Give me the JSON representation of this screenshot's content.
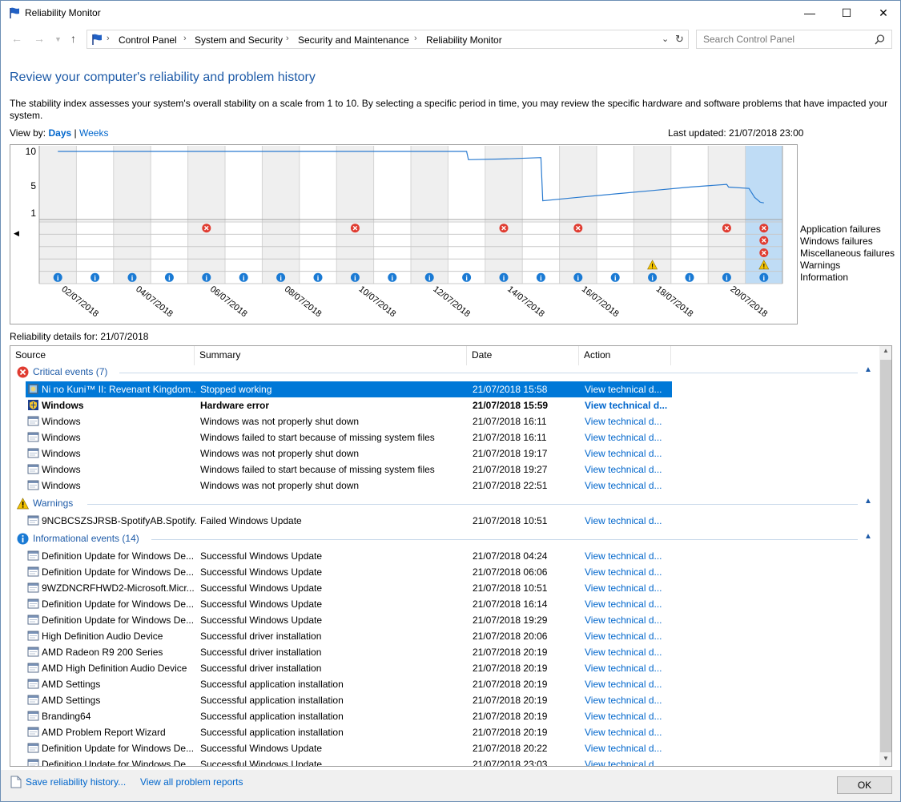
{
  "window": {
    "title": "Reliability Monitor",
    "minimize_glyph": "—",
    "maximize_glyph": "☐",
    "close_glyph": "✕"
  },
  "nav": {
    "breadcrumbs": [
      "Control Panel",
      "System and Security",
      "Security and Maintenance",
      "Reliability Monitor"
    ],
    "search_placeholder": "Search Control Panel"
  },
  "page": {
    "heading": "Review your computer's reliability and problem history",
    "description": "The stability index assesses your system's overall stability on a scale from 1 to 10. By selecting a specific period in time, you may review the specific hardware and software problems that have impacted your system.",
    "view_by_label": "View by:",
    "view_days": "Days",
    "view_sep": "|",
    "view_weeks": "Weeks",
    "last_updated": "Last updated: 21/07/2018 23:00",
    "details_for": "Reliability details for: 21/07/2018"
  },
  "chart_data": {
    "type": "line",
    "y_ticks": [
      "10",
      "5",
      "1"
    ],
    "ylim": [
      1,
      10
    ],
    "x_labels": [
      "02/07/2018",
      "04/07/2018",
      "06/07/2018",
      "08/07/2018",
      "10/07/2018",
      "12/07/2018",
      "14/07/2018",
      "16/07/2018",
      "18/07/2018",
      "20/07/2018"
    ],
    "day_count": 20,
    "selected_day": 20,
    "stability_index": [
      [
        1,
        10
      ],
      [
        2,
        10
      ],
      [
        3,
        10
      ],
      [
        4,
        10
      ],
      [
        5,
        10
      ],
      [
        6,
        10
      ],
      [
        7,
        10
      ],
      [
        8,
        10
      ],
      [
        9,
        10
      ],
      [
        10,
        10
      ],
      [
        11,
        10
      ],
      [
        12,
        10
      ],
      [
        12.05,
        8.8
      ],
      [
        13,
        8.9
      ],
      [
        14,
        9.1
      ],
      [
        14.05,
        2.8
      ],
      [
        15,
        3.3
      ],
      [
        16,
        3.8
      ],
      [
        17,
        4.3
      ],
      [
        18,
        4.8
      ],
      [
        19,
        5.2
      ],
      [
        19.05,
        4.8
      ],
      [
        19.6,
        4.6
      ],
      [
        19.75,
        3.3
      ],
      [
        19.9,
        2.6
      ],
      [
        20,
        2.5
      ]
    ],
    "legend": [
      "Application failures",
      "Windows failures",
      "Miscellaneous failures",
      "Warnings",
      "Information"
    ],
    "events": {
      "application_failures": [
        5,
        9,
        13,
        15,
        19,
        20
      ],
      "windows_failures": [
        20
      ],
      "miscellaneous_failures": [
        20
      ],
      "warnings": [
        17,
        20
      ],
      "information": [
        1,
        2,
        3,
        4,
        5,
        6,
        7,
        8,
        9,
        10,
        11,
        12,
        13,
        14,
        15,
        16,
        17,
        18,
        19,
        20
      ]
    }
  },
  "columns": [
    "Source",
    "Summary",
    "Date",
    "Action"
  ],
  "groups": [
    {
      "label": "Critical events (7)",
      "icon": "error",
      "rows": [
        {
          "source": "Ni no Kuni™ II: Revenant Kingdom...",
          "summary": "Stopped working",
          "date": "21/07/2018 15:58",
          "action": "View  technical d...",
          "icon": "app",
          "selected": true
        },
        {
          "source": "Windows",
          "summary": "Hardware error",
          "date": "21/07/2018 15:59",
          "action": "View  technical d...",
          "icon": "shield",
          "bold": true
        },
        {
          "source": "Windows",
          "summary": "Windows was not properly shut down",
          "date": "21/07/2018 16:11",
          "action": "View  technical d...",
          "icon": "window"
        },
        {
          "source": "Windows",
          "summary": "Windows failed to start because of missing system files",
          "date": "21/07/2018 16:11",
          "action": "View  technical d...",
          "icon": "window"
        },
        {
          "source": "Windows",
          "summary": "Windows was not properly shut down",
          "date": "21/07/2018 19:17",
          "action": "View  technical d...",
          "icon": "window"
        },
        {
          "source": "Windows",
          "summary": "Windows failed to start because of missing system files",
          "date": "21/07/2018 19:27",
          "action": "View  technical d...",
          "icon": "window"
        },
        {
          "source": "Windows",
          "summary": "Windows was not properly shut down",
          "date": "21/07/2018 22:51",
          "action": "View  technical d...",
          "icon": "window"
        }
      ]
    },
    {
      "label": "Warnings",
      "icon": "warning",
      "rows": [
        {
          "source": "9NCBCSZSJRSB-SpotifyAB.Spotify...",
          "summary": "Failed Windows Update",
          "date": "21/07/2018 10:51",
          "action": "View  technical d...",
          "icon": "window"
        }
      ]
    },
    {
      "label": "Informational events (14)",
      "icon": "info",
      "rows": [
        {
          "source": "Definition Update for Windows De...",
          "summary": "Successful Windows Update",
          "date": "21/07/2018 04:24",
          "action": "View  technical d...",
          "icon": "window"
        },
        {
          "source": "Definition Update for Windows De...",
          "summary": "Successful Windows Update",
          "date": "21/07/2018 06:06",
          "action": "View  technical d...",
          "icon": "window"
        },
        {
          "source": "9WZDNCRFHWD2-Microsoft.Micr...",
          "summary": "Successful Windows Update",
          "date": "21/07/2018 10:51",
          "action": "View  technical d...",
          "icon": "window"
        },
        {
          "source": "Definition Update for Windows De...",
          "summary": "Successful Windows Update",
          "date": "21/07/2018 16:14",
          "action": "View  technical d...",
          "icon": "window"
        },
        {
          "source": "Definition Update for Windows De...",
          "summary": "Successful Windows Update",
          "date": "21/07/2018 19:29",
          "action": "View  technical d...",
          "icon": "window"
        },
        {
          "source": "High Definition Audio Device",
          "summary": "Successful driver installation",
          "date": "21/07/2018 20:06",
          "action": "View  technical d...",
          "icon": "window"
        },
        {
          "source": "AMD Radeon R9 200 Series",
          "summary": "Successful driver installation",
          "date": "21/07/2018 20:19",
          "action": "View  technical d...",
          "icon": "window"
        },
        {
          "source": "AMD High Definition Audio Device",
          "summary": "Successful driver installation",
          "date": "21/07/2018 20:19",
          "action": "View  technical d...",
          "icon": "window"
        },
        {
          "source": "AMD Settings",
          "summary": "Successful application installation",
          "date": "21/07/2018 20:19",
          "action": "View  technical d...",
          "icon": "window"
        },
        {
          "source": "AMD Settings",
          "summary": "Successful application installation",
          "date": "21/07/2018 20:19",
          "action": "View  technical d...",
          "icon": "window"
        },
        {
          "source": "Branding64",
          "summary": "Successful application installation",
          "date": "21/07/2018 20:19",
          "action": "View  technical d...",
          "icon": "window"
        },
        {
          "source": "AMD Problem Report Wizard",
          "summary": "Successful application installation",
          "date": "21/07/2018 20:19",
          "action": "View  technical d...",
          "icon": "window"
        },
        {
          "source": "Definition Update for Windows De...",
          "summary": "Successful Windows Update",
          "date": "21/07/2018 20:22",
          "action": "View  technical d...",
          "icon": "window"
        },
        {
          "source": "Definition Update for Windows De...",
          "summary": "Successful Windows Update",
          "date": "21/07/2018 23:03",
          "action": "View  technical d...",
          "icon": "window"
        }
      ]
    }
  ],
  "footer": {
    "save_history": "Save reliability history...",
    "view_reports": "View all problem reports",
    "ok": "OK"
  },
  "colors": {
    "accent": "#1e5ba8",
    "link": "#0066cc",
    "selection": "#0078d7",
    "line": "#2a7bd0",
    "selected_day": "#bfdcf5",
    "error": "#e03c31",
    "warning": "#f5c400",
    "info": "#1a7ad4"
  }
}
